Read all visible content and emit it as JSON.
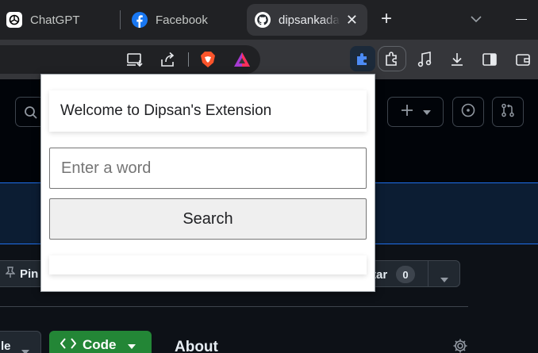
{
  "browser": {
    "tabs": [
      {
        "title": "ChatGPT",
        "icon": "chatgpt-icon"
      },
      {
        "title": "Facebook",
        "icon": "facebook-icon"
      },
      {
        "title": "dipsankadar",
        "icon": "github-icon",
        "active": true
      }
    ],
    "new_tab_glyph": "+",
    "close_glyph": "✕",
    "toolbar_icons": [
      "install-app-icon",
      "share-icon",
      "brave-shields-icon",
      "brave-rewards-icon",
      "extension-puzzle-icon",
      "extensions-menu-icon",
      "media-icon",
      "downloads-icon",
      "sidebar-icon",
      "wallet-icon"
    ]
  },
  "github": {
    "pin_label": "Pin",
    "star_label": "tar",
    "star_count": "0",
    "branch_label": "le",
    "code_label": "Code",
    "about_label": "About"
  },
  "extension": {
    "welcome_text": "Welcome to Dipsan's Extension",
    "input_placeholder": "Enter a word",
    "input_value": "",
    "search_label": "Search",
    "result_text": ""
  },
  "colors": {
    "tabstrip_bg": "#202124",
    "toolbar_bg": "#35363a",
    "github_bg": "#0d1117",
    "code_button": "#238636",
    "popup_bg": "#ffffff"
  }
}
